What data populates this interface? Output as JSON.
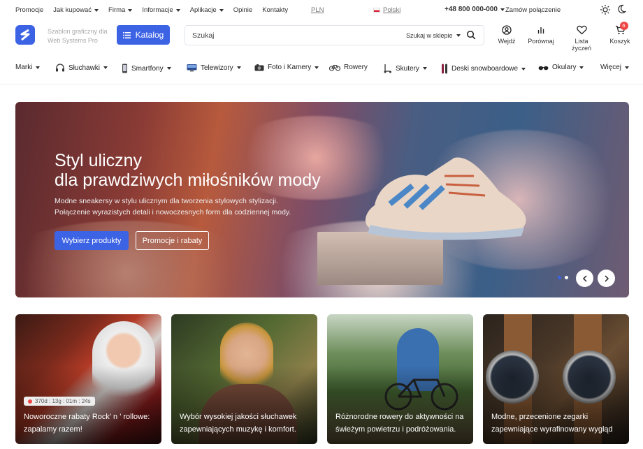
{
  "topbar": {
    "links": [
      {
        "label": "Promocje",
        "dropdown": false
      },
      {
        "label": "Jak kupować",
        "dropdown": true
      },
      {
        "label": "Firma",
        "dropdown": true
      },
      {
        "label": "Informacje",
        "dropdown": true
      },
      {
        "label": "Aplikacje",
        "dropdown": true
      },
      {
        "label": "Opinie",
        "dropdown": false
      },
      {
        "label": "Kontakty",
        "dropdown": false
      }
    ],
    "currency": "PLN",
    "language": "Polski",
    "phone": "+48 800 000-000",
    "callback": "Zamów połączenie"
  },
  "header": {
    "tagline": "Szablon graficzny dla Web Systems Pro",
    "catalog_label": "Katalog",
    "search_placeholder": "Szukaj",
    "search_scope": "Szukaj w sklepie",
    "actions": {
      "login": "Wejdź",
      "compare": "Porównaj",
      "wishlist": "Lista życzeń",
      "cart": "Koszyk",
      "cart_count": "6"
    }
  },
  "nav": [
    {
      "label": "Marki",
      "icon": "",
      "dropdown": true
    },
    {
      "label": "Słuchawki",
      "icon": "headphones-icon",
      "dropdown": true
    },
    {
      "label": "Smartfony",
      "icon": "smartphone-icon",
      "dropdown": true
    },
    {
      "label": "Telewizory",
      "icon": "tv-icon",
      "dropdown": true
    },
    {
      "label": "Foto i Kamery",
      "icon": "camera-icon",
      "dropdown": true
    },
    {
      "label": "Rowery",
      "icon": "bicycle-icon",
      "dropdown": false
    },
    {
      "label": "Skutery",
      "icon": "scooter-icon",
      "dropdown": true
    },
    {
      "label": "Deski snowboardowe",
      "icon": "snowboard-icon",
      "dropdown": true
    },
    {
      "label": "Okulary",
      "icon": "glasses-icon",
      "dropdown": true
    },
    {
      "label": "Więcej",
      "icon": "",
      "dropdown": true
    }
  ],
  "hero": {
    "title_line1": "Styl uliczny",
    "title_line2": "dla prawdziwych miłośników mody",
    "desc_line1": "Modne sneakersy w stylu ulicznym dla tworzenia stylowych stylizacji.",
    "desc_line2": "Połączenie wyrazistych detali i nowoczesnych form dla codziennej mody.",
    "primary_button": "Wybierz produkty",
    "secondary_button": "Promocje i rabaty",
    "slide_count": 2,
    "active_slide": 1
  },
  "cards": [
    {
      "caption": "Noworoczne rabaty Rock' n ' rollowe: zapalamy razem!",
      "timer": "370d : 13g : 01m : 24s"
    },
    {
      "caption": "Wybór wysokiej jakości słuchawek zapewniających muzykę i komfort."
    },
    {
      "caption": "Różnorodne rowery do aktywności na świeżym powietrzu i podróżowania."
    },
    {
      "caption": "Modne, przecenione zegarki zapewniające wyrafinowany wygląd"
    }
  ],
  "colors": {
    "accent": "#3d63e5",
    "badge": "#e44444"
  }
}
